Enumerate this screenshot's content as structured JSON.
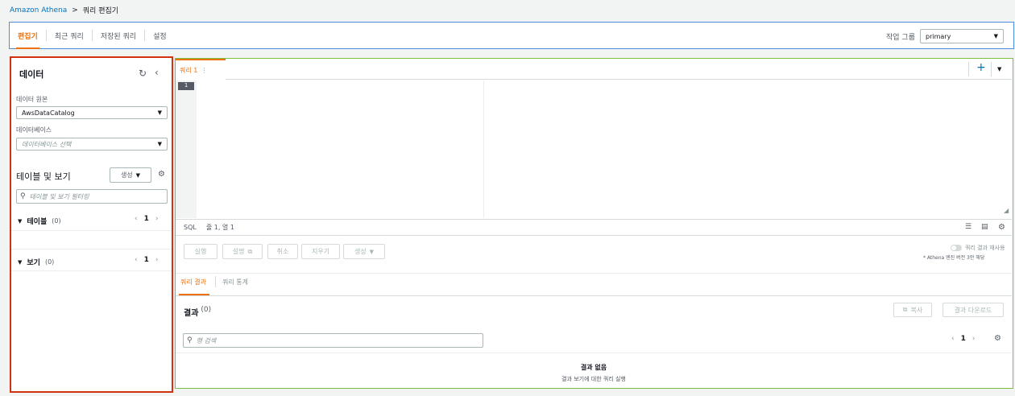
{
  "breadcrumb": {
    "root": "Amazon Athena",
    "sep": ">",
    "current": "쿼리 편집기"
  },
  "tabs": [
    {
      "label": "편집기",
      "selected": true
    },
    {
      "label": "최근 쿼리"
    },
    {
      "label": "저장된 쿼리"
    },
    {
      "label": "설정"
    }
  ],
  "workgroup": {
    "label": "작업 그룹",
    "value": "primary"
  },
  "left": {
    "title": "데이터",
    "source_label": "데이터 원본",
    "source_value": "AwsDataCatalog",
    "db_label": "데이터베이스",
    "db_placeholder": "데이터베이스 선택",
    "tv_title": "테이블 및 보기",
    "create_label": "생성",
    "filter_placeholder": "테이블 및 보기 필터링",
    "tables": {
      "label": "테이블",
      "count": "(0)",
      "page": "1"
    },
    "views": {
      "label": "보기",
      "count": "(0)",
      "page": "1"
    }
  },
  "editor": {
    "query_tab": "쿼리 1",
    "line_no": "1",
    "status_lang": "SQL",
    "status_pos": "줄 1, 열 1"
  },
  "actions": {
    "run": "실행",
    "explain": "설명",
    "cancel": "취소",
    "clear": "지우기",
    "create": "생성",
    "reuse": "쿼리 결과 재사용",
    "reuse_note": "* Athena 엔진 버전 3만 해당"
  },
  "results": {
    "tab_results": "쿼리 결과",
    "tab_stats": "쿼리 통계",
    "title": "결과",
    "count": "(0)",
    "copy": "복사",
    "download": "결과 다운로드",
    "search_placeholder": "행 검색",
    "page": "1",
    "empty_title": "결과 없음",
    "empty_sub": "결과 보기에 대한 쿼리 실행"
  },
  "colors": {
    "accent": "#ec7211",
    "link": "#0073bb",
    "left_border": "#d13212",
    "main_border": "#7ac143",
    "tab_border": "#4a90e2"
  }
}
